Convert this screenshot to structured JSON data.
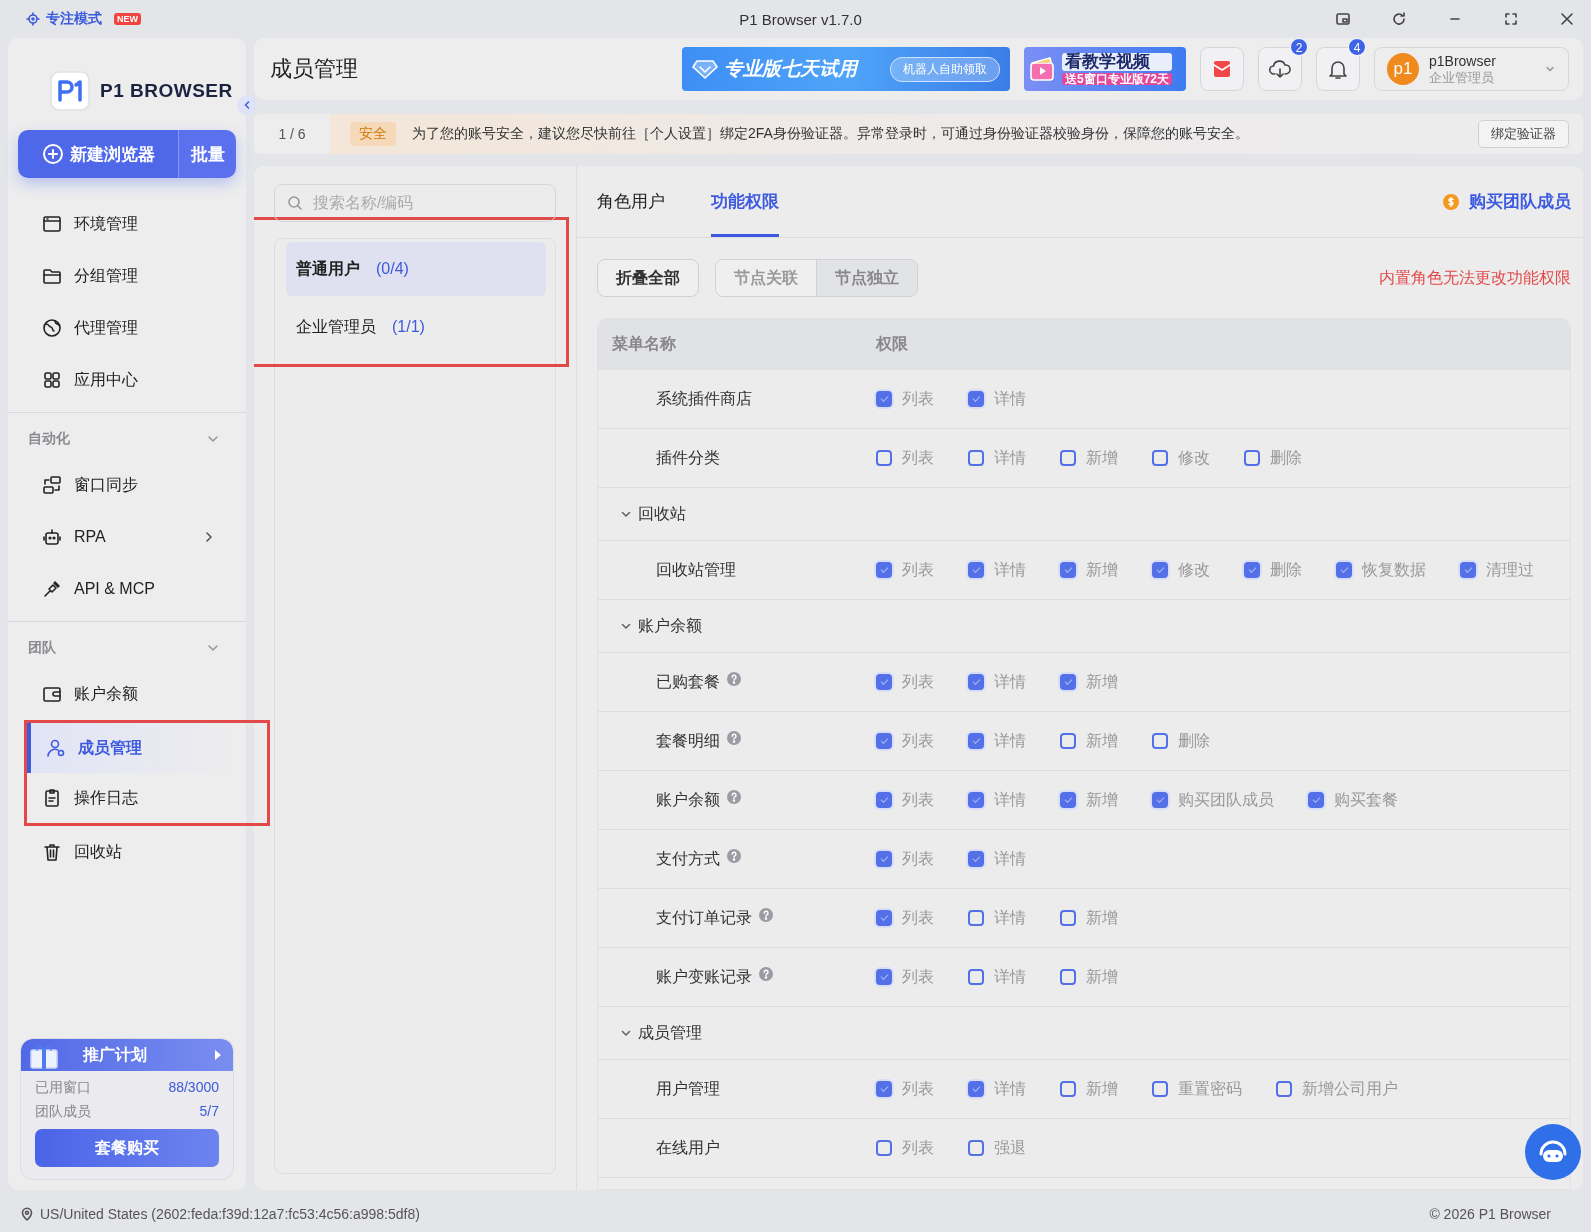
{
  "titlebar": {
    "focus_mode": "专注模式",
    "badge": "NEW",
    "title": "P1 Browser v1.7.0"
  },
  "sidebar": {
    "logo": "P1 BROWSER",
    "new_button": "新建浏览器",
    "batch_button": "批量",
    "items": [
      {
        "label": "环境管理",
        "selected": false,
        "has_submenu": false,
        "highlighted": false
      },
      {
        "label": "分组管理",
        "selected": false,
        "has_submenu": false,
        "highlighted": false
      },
      {
        "label": "代理管理",
        "selected": false,
        "has_submenu": false,
        "highlighted": false
      },
      {
        "label": "应用中心",
        "selected": false,
        "has_submenu": false,
        "highlighted": false
      }
    ],
    "sections": [
      {
        "title": "自动化",
        "expanded": true,
        "items": [
          {
            "label": "窗口同步",
            "selected": false,
            "has_submenu": false,
            "highlighted": false
          },
          {
            "label": "RPA",
            "selected": false,
            "has_submenu": true,
            "highlighted": false
          },
          {
            "label": "API & MCP",
            "selected": false,
            "has_submenu": false,
            "highlighted": false
          }
        ]
      },
      {
        "title": "团队",
        "expanded": true,
        "items": [
          {
            "label": "账户余额",
            "selected": false,
            "has_submenu": false,
            "highlighted": false
          },
          {
            "label": "成员管理",
            "selected": true,
            "has_submenu": false,
            "highlighted": true
          },
          {
            "label": "操作日志",
            "selected": false,
            "has_submenu": false,
            "highlighted": true
          },
          {
            "label": "回收站",
            "selected": false,
            "has_submenu": false,
            "highlighted": false
          }
        ]
      }
    ],
    "promo": {
      "title": "推广计划",
      "stats": [
        {
          "label": "已用窗口",
          "value": "88/3000"
        },
        {
          "label": "团队成员",
          "value": "5/7"
        }
      ],
      "button": "套餐购买"
    }
  },
  "header": {
    "title": "成员管理",
    "trial_banner": {
      "text": "专业版七天试用",
      "pill": "机器人自助领取"
    },
    "video_banner": {
      "title": "看教学视频",
      "subtitle": "送5窗口专业版72天"
    },
    "download_badge": "2",
    "notification_badge": "4",
    "user": {
      "avatar": "p1",
      "name": "p1Browser",
      "role": "企业管理员"
    }
  },
  "notice": {
    "pager": "1 / 6",
    "tag": "安全",
    "text": "为了您的账号安全，建议您尽快前往［个人设置］绑定2FA身份验证器。异常登录时，可通过身份验证器校验身份，保障您的账号安全。",
    "button": "绑定验证器"
  },
  "roles": {
    "search": {
      "placeholder": "搜索名称/编码"
    },
    "highlighted": true,
    "items": [
      {
        "name": "普通用户",
        "count": "(0/4)",
        "selected": true
      },
      {
        "name": "企业管理员",
        "count": "(1/1)",
        "selected": false
      }
    ]
  },
  "permissions": {
    "tabs": [
      {
        "label": "角色用户",
        "selected": false
      },
      {
        "label": "功能权限",
        "selected": true
      }
    ],
    "buy_link": "购买团队成员",
    "collapse_button": "折叠全部",
    "modes": [
      {
        "label": "节点关联",
        "selected": false
      },
      {
        "label": "节点独立",
        "selected": true
      }
    ],
    "warning": "内置角色无法更改功能权限",
    "columns": [
      "菜单名称",
      "权限"
    ],
    "rows": [
      {
        "kind": "item",
        "label": "系统插件商店",
        "help": false,
        "perms": [
          {
            "label": "列表",
            "checked": true
          },
          {
            "label": "详情",
            "checked": true
          }
        ]
      },
      {
        "kind": "item",
        "label": "插件分类",
        "help": false,
        "perms": [
          {
            "label": "列表",
            "checked": false
          },
          {
            "label": "详情",
            "checked": false
          },
          {
            "label": "新增",
            "checked": false
          },
          {
            "label": "修改",
            "checked": false
          },
          {
            "label": "删除",
            "checked": false
          }
        ]
      },
      {
        "kind": "group",
        "label": "回收站",
        "expanded": true
      },
      {
        "kind": "item",
        "label": "回收站管理",
        "help": false,
        "perms": [
          {
            "label": "列表",
            "checked": true
          },
          {
            "label": "详情",
            "checked": true
          },
          {
            "label": "新增",
            "checked": true
          },
          {
            "label": "修改",
            "checked": true
          },
          {
            "label": "删除",
            "checked": true
          },
          {
            "label": "恢复数据",
            "checked": true
          },
          {
            "label": "清理过",
            "checked": true
          }
        ]
      },
      {
        "kind": "group",
        "label": "账户余额",
        "expanded": true
      },
      {
        "kind": "item",
        "label": "已购套餐",
        "help": true,
        "perms": [
          {
            "label": "列表",
            "checked": true
          },
          {
            "label": "详情",
            "checked": true
          },
          {
            "label": "新增",
            "checked": true
          }
        ]
      },
      {
        "kind": "item",
        "label": "套餐明细",
        "help": true,
        "perms": [
          {
            "label": "列表",
            "checked": true
          },
          {
            "label": "详情",
            "checked": true
          },
          {
            "label": "新增",
            "checked": false
          },
          {
            "label": "删除",
            "checked": false
          }
        ]
      },
      {
        "kind": "item",
        "label": "账户余额",
        "help": true,
        "perms": [
          {
            "label": "列表",
            "checked": true
          },
          {
            "label": "详情",
            "checked": true
          },
          {
            "label": "新增",
            "checked": true
          },
          {
            "label": "购买团队成员",
            "checked": true
          },
          {
            "label": "购买套餐",
            "checked": true
          }
        ]
      },
      {
        "kind": "item",
        "label": "支付方式",
        "help": true,
        "perms": [
          {
            "label": "列表",
            "checked": true
          },
          {
            "label": "详情",
            "checked": true
          }
        ]
      },
      {
        "kind": "item",
        "label": "支付订单记录",
        "help": true,
        "perms": [
          {
            "label": "列表",
            "checked": true
          },
          {
            "label": "详情",
            "checked": false
          },
          {
            "label": "新增",
            "checked": false
          }
        ]
      },
      {
        "kind": "item",
        "label": "账户变账记录",
        "help": true,
        "perms": [
          {
            "label": "列表",
            "checked": true
          },
          {
            "label": "详情",
            "checked": false
          },
          {
            "label": "新增",
            "checked": false
          }
        ]
      },
      {
        "kind": "group",
        "label": "成员管理",
        "expanded": true
      },
      {
        "kind": "item",
        "label": "用户管理",
        "help": false,
        "perms": [
          {
            "label": "列表",
            "checked": true
          },
          {
            "label": "详情",
            "checked": true
          },
          {
            "label": "新增",
            "checked": false
          },
          {
            "label": "重置密码",
            "checked": false
          },
          {
            "label": "新增公司用户",
            "checked": false
          }
        ]
      },
      {
        "kind": "item",
        "label": "在线用户",
        "help": false,
        "perms": [
          {
            "label": "列表",
            "checked": false
          },
          {
            "label": "强退",
            "checked": false
          }
        ]
      }
    ]
  },
  "status_bar": {
    "location": "US/United States (2602:feda:f39d:12a7:fc53:4c56:a998:5df8)",
    "copyright": "© 2026 P1 Browser"
  }
}
